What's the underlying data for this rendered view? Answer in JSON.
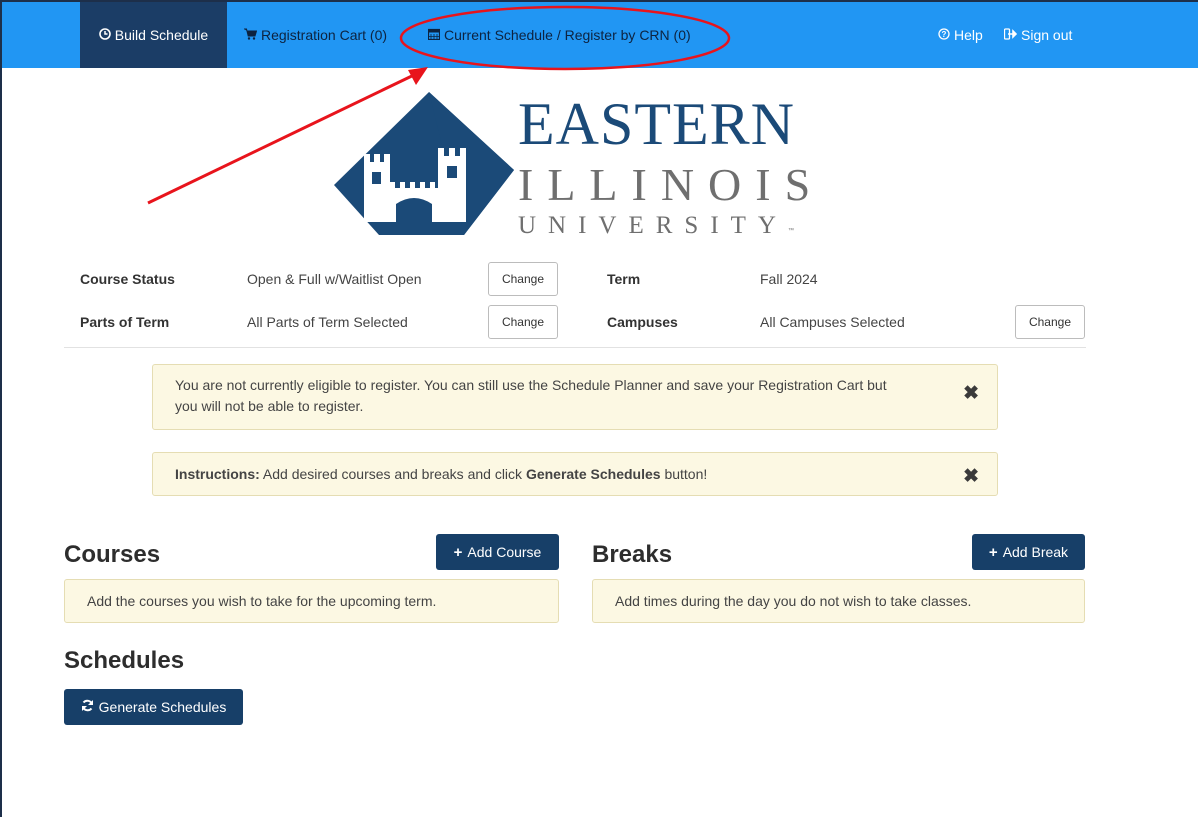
{
  "nav": {
    "build_schedule": "Build Schedule",
    "registration_cart": "Registration Cart (0)",
    "current_schedule": "Current Schedule / Register by CRN (0)",
    "help": "Help",
    "sign_out": "Sign out"
  },
  "logo": {
    "line1": "EASTERN",
    "line2": "ILLINOIS",
    "line3": "UNIVERSITY",
    "trademark": "™"
  },
  "settings": {
    "course_status_label": "Course Status",
    "course_status_value": "Open & Full w/Waitlist Open",
    "term_label": "Term",
    "term_value": "Fall 2024",
    "parts_of_term_label": "Parts of Term",
    "parts_of_term_value": "All Parts of Term Selected",
    "campuses_label": "Campuses",
    "campuses_value": "All Campuses Selected",
    "change_label": "Change"
  },
  "alerts": {
    "eligibility": "You are not currently eligible to register. You can still use the Schedule Planner and save your Registration Cart but you will not be able to register.",
    "instructions_prefix": "Instructions:",
    "instructions_text": " Add desired courses and breaks and click ",
    "instructions_bold": "Generate Schedules",
    "instructions_suffix": " button!"
  },
  "courses": {
    "title": "Courses",
    "add_label": "Add Course",
    "empty_text": "Add the courses you wish to take for the upcoming term."
  },
  "breaks": {
    "title": "Breaks",
    "add_label": "Add Break",
    "empty_text": "Add times during the day you do not wish to take classes."
  },
  "schedules": {
    "title": "Schedules",
    "generate_label": "Generate Schedules"
  },
  "colors": {
    "nav_bg": "#2196f3",
    "nav_active": "#1b3d66",
    "primary_button": "#173f68",
    "alert_bg": "#fcf8e3",
    "annotation": "#e8141c",
    "brand_blue": "#1b4a78"
  },
  "icons": {
    "build_schedule": "clock-icon",
    "registration_cart": "cart-icon",
    "current_schedule": "calendar-icon",
    "help": "question-circle-icon",
    "sign_out": "sign-out-icon",
    "alert_close": "close-icon",
    "add": "plus-icon",
    "generate": "refresh-icon"
  }
}
